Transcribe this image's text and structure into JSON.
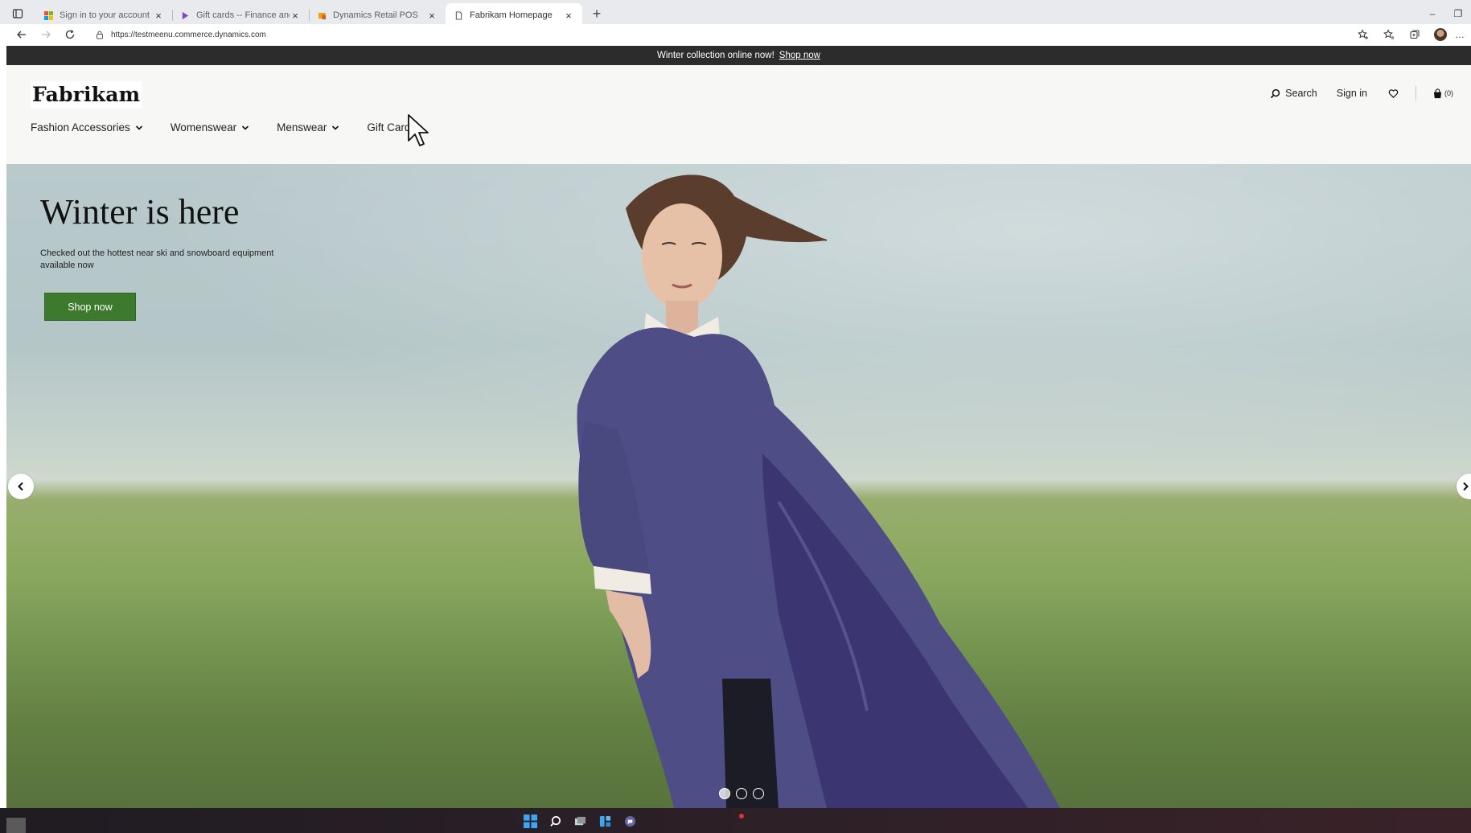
{
  "browser": {
    "tabs": [
      {
        "title": "Sign in to your account",
        "active": false
      },
      {
        "title": "Gift cards -- Finance and Operat",
        "active": false
      },
      {
        "title": "Dynamics Retail POS",
        "active": false
      },
      {
        "title": "Fabrikam Homepage",
        "active": true
      }
    ],
    "url": "https://testmeenu.commerce.dynamics.com"
  },
  "site": {
    "promo_text": "Winter collection online now!",
    "promo_link": "Shop now",
    "logo": "Fabrikam",
    "header": {
      "search_label": "Search",
      "signin_label": "Sign in",
      "cart_count": "(0)"
    },
    "nav": [
      {
        "label": "Fashion Accessories",
        "has_menu": true
      },
      {
        "label": "Womenswear",
        "has_menu": true
      },
      {
        "label": "Menswear",
        "has_menu": true
      },
      {
        "label": "Gift Cards",
        "has_menu": false
      }
    ],
    "hero": {
      "title": "Winter is here",
      "subtitle": "Checked out the hottest near ski and snowboard equipment available now",
      "button_label": "Shop now",
      "slides_total": 3,
      "active_slide": 1
    }
  },
  "colors": {
    "promo_bg": "#2c2c2c",
    "cta_green": "#3d7a2e",
    "page_bg": "#f7f7f5"
  }
}
